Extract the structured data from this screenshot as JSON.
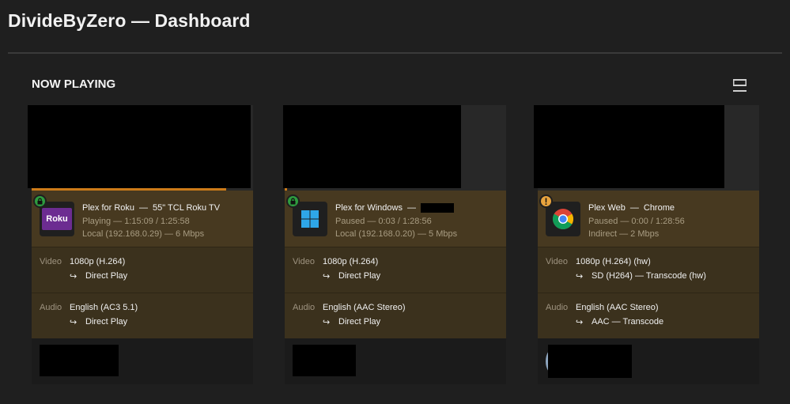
{
  "header": {
    "title": "DivideByZero — Dashboard"
  },
  "section": {
    "title": "NOW PLAYING"
  },
  "colors": {
    "accent": "#cc7b19",
    "info_bg": "#473920",
    "detail_bg": "#3b311d",
    "lock_green": "#2e9c3f",
    "warn_orange": "#e8a33d"
  },
  "sessions": [
    {
      "progress": 0.88,
      "badge": "lock-icon",
      "player_icon": "roku-icon",
      "player_logo_text": "Roku",
      "player": "Plex for Roku",
      "device": "55\" TCL Roku TV",
      "state": "Playing — 1:15:09 / 1:25:58",
      "location": "Local (192.168.0.29) — 6 Mbps",
      "video_label": "Video",
      "video_value": "1080p (H.264)",
      "video_action": "Direct Play",
      "audio_label": "Audio",
      "audio_value": "English (AC3 5.1)",
      "audio_action": "Direct Play"
    },
    {
      "progress": 0.01,
      "badge": "lock-icon",
      "player_icon": "windows-icon",
      "player": "Plex for Windows",
      "device": "",
      "state": "Paused — 0:03 / 1:28:56",
      "location": "Local (192.168.0.20) — 5 Mbps",
      "video_label": "Video",
      "video_value": "1080p (H.264)",
      "video_action": "Direct Play",
      "audio_label": "Audio",
      "audio_value": "English (AAC Stereo)",
      "audio_action": "Direct Play"
    },
    {
      "progress": 0.0,
      "badge": "warning-icon",
      "player_icon": "chrome-icon",
      "player": "Plex Web",
      "device": "Chrome",
      "state": "Paused — 0:00 / 1:28:56",
      "location": "Indirect — 2 Mbps",
      "video_label": "Video",
      "video_value": "1080p (H.264) (hw)",
      "video_action": "SD (H264) — Transcode (hw)",
      "audio_label": "Audio",
      "audio_value": "English (AAC Stereo)",
      "audio_action": "AAC — Transcode"
    }
  ]
}
